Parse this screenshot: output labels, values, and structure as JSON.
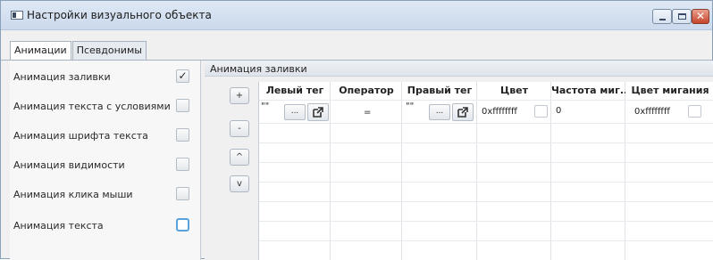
{
  "window": {
    "title": "Настройки визуального объекта",
    "close_glyph": "✕"
  },
  "tabs": [
    {
      "label": "Анимации",
      "active": true
    },
    {
      "label": "Псевдонимы",
      "active": false
    }
  ],
  "animations": [
    {
      "label": "Анимация заливки",
      "checked": true,
      "check_glyph": "✓"
    },
    {
      "label": "Анимация текста с условиями",
      "checked": false
    },
    {
      "label": "Анимация шрифта текста",
      "checked": false
    },
    {
      "label": "Анимация видимости",
      "checked": false
    },
    {
      "label": "Анимация клика мыши",
      "checked": false
    },
    {
      "label": "Анимация текста",
      "checked": false,
      "focused": true
    }
  ],
  "panel": {
    "title": "Анимация заливки",
    "side_buttons": [
      "+",
      "-",
      "^",
      "v"
    ]
  },
  "table": {
    "columns": [
      "Левый тег",
      "Оператор",
      "Правый тег",
      "Цвет",
      "Частота миг...",
      "Цвет мигания"
    ],
    "row": {
      "left_tag": "\"\"",
      "left_tag_button": "...",
      "operator": "=",
      "right_tag": "\"\"",
      "right_tag_button": "...",
      "color": "0xffffffff",
      "blink_freq": "0",
      "blink_color": "0xffffffff"
    }
  },
  "colors": {
    "accent": "#5aa2dc",
    "close": "#c7452d"
  }
}
